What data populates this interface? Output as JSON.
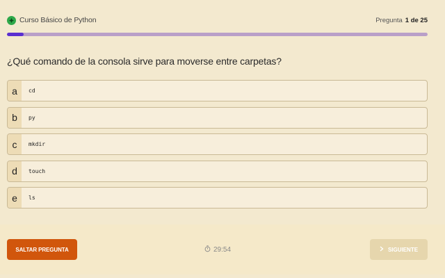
{
  "header": {
    "course_title": "Curso Básico de Python",
    "counter_label": "Pregunta",
    "counter_value": "1 de 25"
  },
  "progress": {
    "fraction": 0.04
  },
  "question": {
    "text": "¿Qué comando de la consola sirve para moverse entre carpetas?"
  },
  "options": [
    {
      "letter": "a",
      "text": "cd"
    },
    {
      "letter": "b",
      "text": "py"
    },
    {
      "letter": "c",
      "text": "mkdir"
    },
    {
      "letter": "d",
      "text": "touch"
    },
    {
      "letter": "e",
      "text": "ls"
    }
  ],
  "footer": {
    "skip_label": "SALTAR PREGUNTA",
    "timer": "29:54",
    "next_label": "SIGUIENTE"
  },
  "colors": {
    "background": "#f3e9cf",
    "progress_fill": "#5a2fd0",
    "progress_track": "#b99fc8",
    "skip_button": "#d1560c",
    "next_button_disabled": "#e6d6ad",
    "brand_icon": "#2ea84a"
  },
  "icons": {
    "brand": "logo-icon",
    "timer": "stopwatch-icon",
    "next": "chevron-right-icon"
  }
}
